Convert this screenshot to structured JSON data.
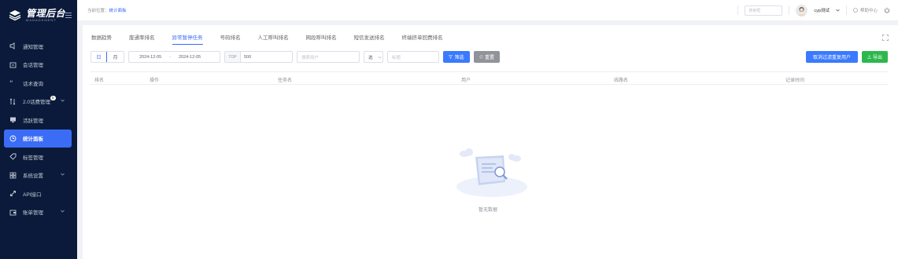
{
  "sidebar": {
    "brand_title": "管理后台",
    "brand_subtitle": "MANAGEMENT",
    "items": [
      {
        "label": "通知管理",
        "icon": "speaker-icon",
        "active": false
      },
      {
        "label": "会话管理",
        "icon": "chat-box-icon",
        "active": false
      },
      {
        "label": "话术查询",
        "icon": "quote-icon",
        "active": false
      },
      {
        "label": "2.0话费管理",
        "icon": "sort-icon",
        "active": false,
        "badge": "5",
        "has_arrow": true
      },
      {
        "label": "活跃管理",
        "icon": "monitor-icon",
        "active": false
      },
      {
        "label": "统计面板",
        "icon": "clock-icon",
        "active": true
      },
      {
        "label": "标签管理",
        "icon": "tag-icon",
        "active": false
      },
      {
        "label": "系统设置",
        "icon": "grid-icon",
        "active": false,
        "has_arrow": true
      },
      {
        "label": "API接口",
        "icon": "link-icon",
        "active": false
      },
      {
        "label": "账单管理",
        "icon": "wallet-icon",
        "active": false,
        "has_arrow": true
      }
    ]
  },
  "header": {
    "breadcrumb_prefix": "当前位置：",
    "breadcrumb_current": "统计面板",
    "search_placeholder": "搜索框",
    "user_name": "cyp测试",
    "help_label": "帮助中心"
  },
  "tabs": [
    "数据趋势",
    "废通率排名",
    "异常暂停任务",
    "号码排名",
    "人工呼叫排名",
    "网段呼叫排名",
    "短信发送排名",
    "终端挤单回费排名"
  ],
  "active_tab": 2,
  "filters": {
    "day_label": "日",
    "month_label": "月",
    "date_start": "2024-12-05",
    "date_sep": "-",
    "date_end": "2024-12-05",
    "top_label": "TOP",
    "top_value": "500",
    "user_placeholder": "搜索用户",
    "select_value": "选",
    "remark_placeholder": "标题",
    "filter_button": "筛选",
    "reset_button": "重置",
    "cancel_filter_button": "取消过滤重复用户",
    "export_button": "导出"
  },
  "table": {
    "columns": [
      "排名",
      "操作",
      "任务名",
      "用户",
      "线路名",
      "记录时间"
    ]
  },
  "empty_text": "暂无数据",
  "colors": {
    "sidebar_bg": "#0b1a3a",
    "accent": "#3a6cf6",
    "green": "#2db84d"
  }
}
